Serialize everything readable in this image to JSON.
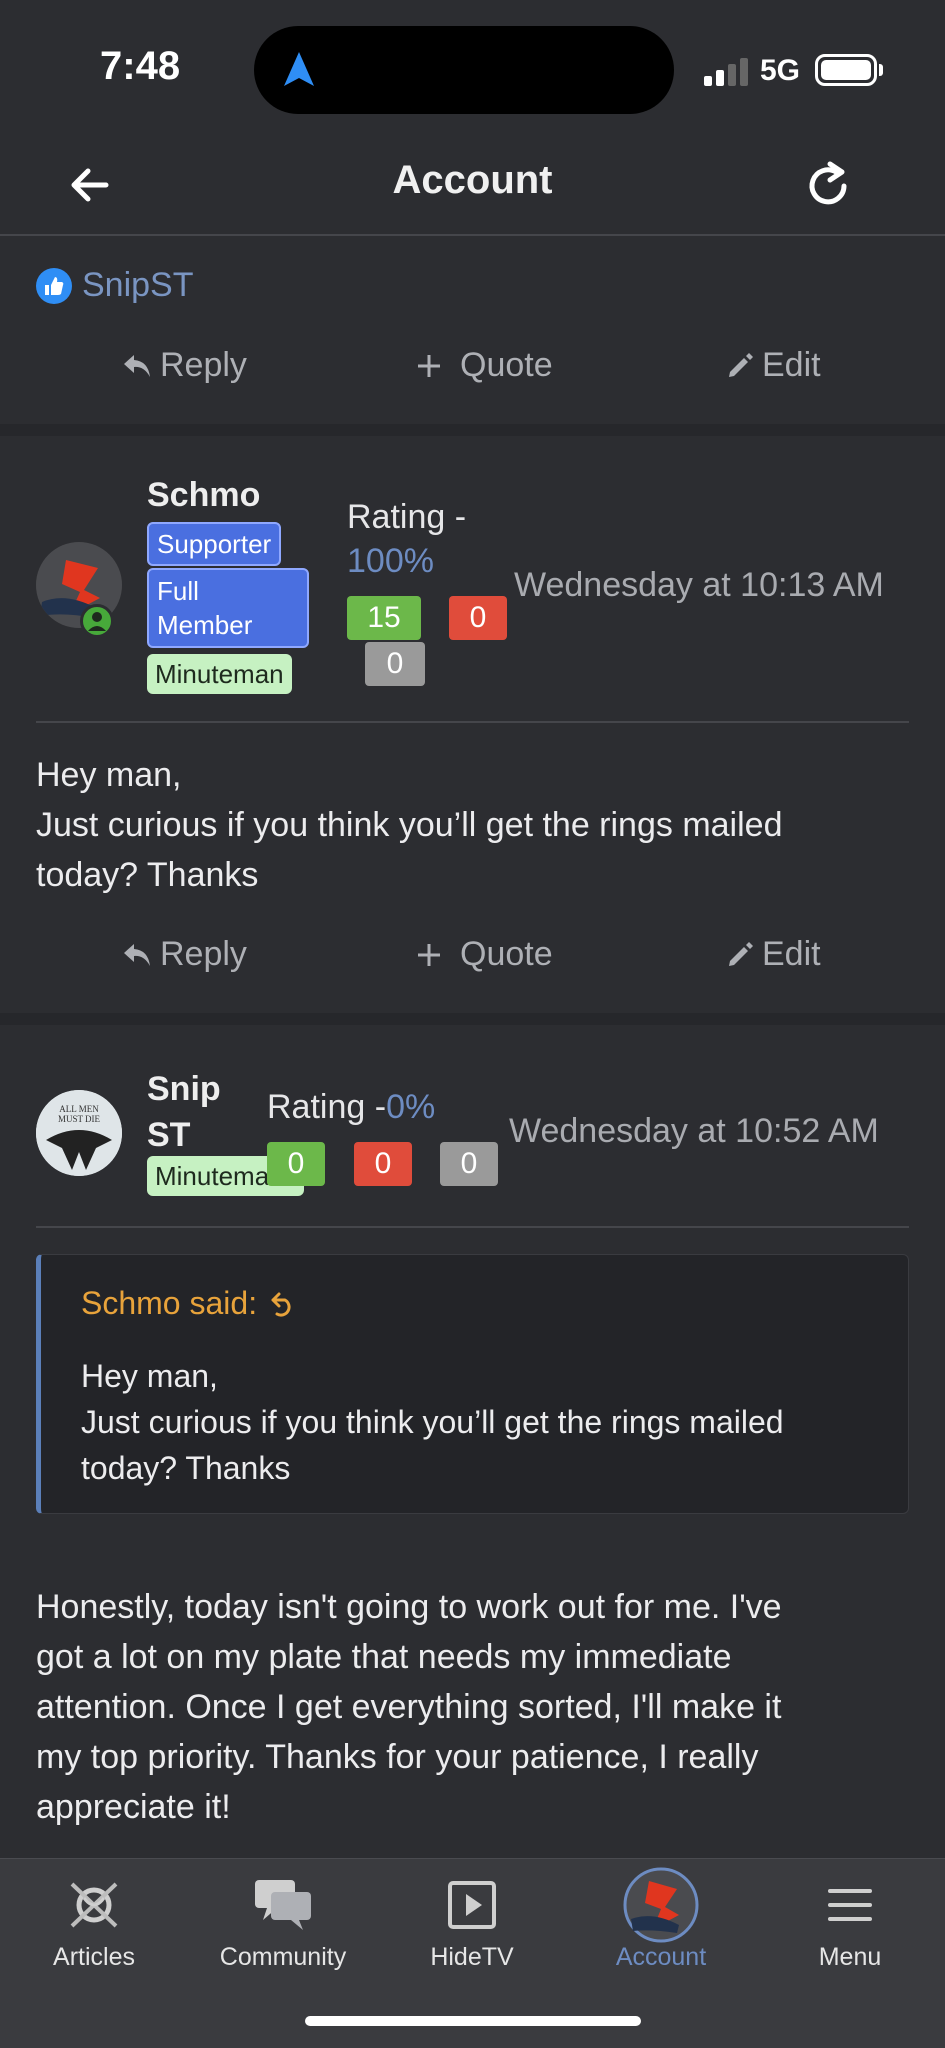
{
  "status_bar": {
    "time": "7:48",
    "network": "5G"
  },
  "header": {
    "title": "Account"
  },
  "liked_by": {
    "name": "SnipST"
  },
  "actions": {
    "reply": "Reply",
    "quote": "Quote",
    "edit": "Edit"
  },
  "posts": [
    {
      "username": "Schmo",
      "badges": [
        "Supporter",
        "Full Member",
        "Minuteman"
      ],
      "rating_label": "Rating -",
      "rating_pct": "100%",
      "positive": "15",
      "negative": "0",
      "neutral": "0",
      "date": "Wednesday at 10:13 AM",
      "body_lines": [
        "Hey man,",
        "Just curious if you think you’ll get the rings mailed",
        "today? Thanks"
      ]
    },
    {
      "username_lines": [
        "Snip",
        "ST"
      ],
      "badges": [
        "Minuteman"
      ],
      "rating_label": "Rating -",
      "rating_pct": "0%",
      "positive": "0",
      "negative": "0",
      "neutral": "0",
      "date": "Wednesday at 10:52 AM",
      "avatar_text": [
        "ALL MEN",
        "MUST DIE"
      ],
      "quote": {
        "author": "Schmo said:",
        "lines": [
          "Hey man,",
          "Just curious if you think you’ll get the rings mailed",
          "today? Thanks"
        ]
      },
      "body_lines": [
        "Honestly, today isn't going to work out for me. I've",
        "got a lot on my plate that needs my immediate",
        "attention. Once I get everything sorted, I'll make it",
        "my top priority. Thanks for your patience, I really",
        "appreciate it!"
      ]
    }
  ],
  "tabbar": {
    "items": [
      {
        "label": "Articles",
        "icon": "articles-icon"
      },
      {
        "label": "Community",
        "icon": "community-icon"
      },
      {
        "label": "HideTV",
        "icon": "play-icon"
      },
      {
        "label": "Account",
        "icon": "avatar-icon",
        "active": true
      },
      {
        "label": "Menu",
        "icon": "menu-icon"
      }
    ]
  },
  "colors": {
    "accent": "#6d8cc2",
    "quote_author": "#e8a33b",
    "positive": "#6cb84a",
    "negative": "#e04c3b",
    "neutral": "#9a9a9a"
  }
}
